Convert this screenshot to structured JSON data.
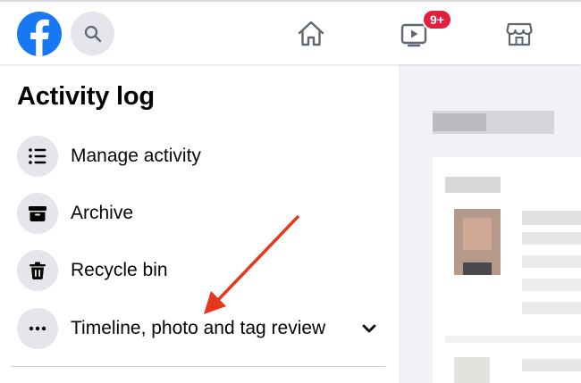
{
  "header": {
    "logo_icon": "facebook-logo-icon",
    "search_icon": "search-icon",
    "nav": [
      {
        "name": "home",
        "icon": "home-icon"
      },
      {
        "name": "watch",
        "icon": "video-play-icon",
        "badge": "9+"
      },
      {
        "name": "marketplace",
        "icon": "marketplace-store-icon"
      }
    ]
  },
  "activity_log": {
    "title": "Activity log",
    "items": [
      {
        "label": "Manage activity",
        "icon": "list-icon"
      },
      {
        "label": "Archive",
        "icon": "archive-box-icon"
      },
      {
        "label": "Recycle bin",
        "icon": "trash-icon"
      },
      {
        "label": "Timeline, photo and tag review",
        "icon": "more-dots-icon",
        "expand_icon": "chevron-down-icon"
      }
    ]
  },
  "annotation": {
    "arrow_color": "#e8371d"
  },
  "colors": {
    "brand": "#1877f2",
    "badge": "#e41e3f",
    "icon_circle": "#e4e6eb",
    "panel_bg": "#f0f2f5"
  }
}
